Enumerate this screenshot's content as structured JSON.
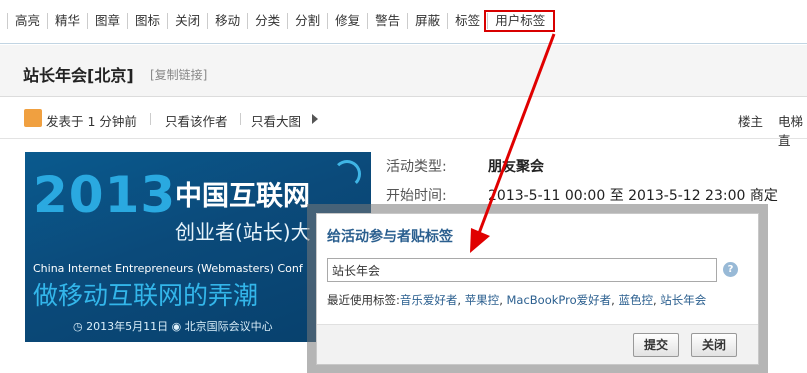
{
  "modbar": {
    "items": [
      "高亮",
      "精华",
      "图章",
      "图标",
      "关闭",
      "移动",
      "分类",
      "分割",
      "修复",
      "警告",
      "屏蔽",
      "标签",
      "用户标签"
    ],
    "highlighted": "用户标签"
  },
  "thread": {
    "title": "站长年会[北京]",
    "copy_link": "[复制链接]"
  },
  "post_meta": {
    "posted": "发表于 1 分钟前",
    "only_author": "只看该作者",
    "big_image": "只看大图",
    "floor": "楼主",
    "elevator": "电梯直"
  },
  "banner": {
    "year": "2013",
    "cn_title": "中国互联网",
    "cn_sub": "创业者(站长)大",
    "en": "China Internet Entrepreneurs (Webmasters) Conf",
    "slogan": "做移动互联网的弄潮",
    "date": "◷ 2013年5月11日   ◉ 北京国际会议中心"
  },
  "activity": {
    "type_label": "活动类型:",
    "type_value": "朋友聚会",
    "start_label": "开始时间:",
    "start_value": "2013-5-11 00:00 至 2013-5-12 23:00 商定"
  },
  "dialog": {
    "title": "给活动参与者贴标签",
    "input_value": "站长年会",
    "help": "?",
    "recent_label": "最近使用标签:",
    "recent_tags": [
      "音乐爱好者",
      "苹果控",
      "MacBookPro爱好者",
      "蓝色控",
      "站长年会"
    ],
    "submit": "提交",
    "close": "关闭"
  },
  "colors": {
    "annotation": "#e00000",
    "link": "#2b5f8f",
    "banner_bg": "#0b4a7a"
  }
}
